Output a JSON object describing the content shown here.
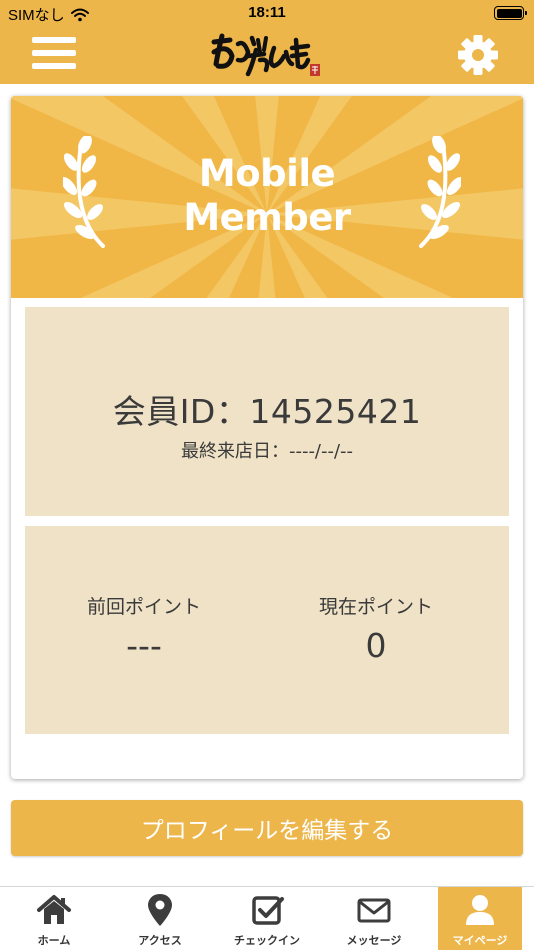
{
  "status_bar": {
    "carrier": "SIMなし",
    "time": "18:11"
  },
  "header": {
    "logo_text": "あかいやんも",
    "menu_icon": "hamburger-menu-icon",
    "settings_icon": "gear-icon"
  },
  "member_card": {
    "banner_line1": "Mobile",
    "banner_line2": "Member",
    "member_id_label": "会員ID：",
    "member_id": "14525421",
    "last_visit_label": "最終来店日：",
    "last_visit_date": "----/--/--",
    "previous_points_label": "前回ポイント",
    "previous_points_value": "---",
    "current_points_label": "現在ポイント",
    "current_points_value": "0"
  },
  "edit_profile_label": "プロフィールを編集する",
  "tabs": [
    {
      "label": "ホーム",
      "icon": "home-icon",
      "active": false
    },
    {
      "label": "アクセス",
      "icon": "map-pin-icon",
      "active": false
    },
    {
      "label": "チェックイン",
      "icon": "checkbox-icon",
      "active": false
    },
    {
      "label": "メッセージ",
      "icon": "envelope-icon",
      "active": false
    },
    {
      "label": "マイページ",
      "icon": "user-icon",
      "active": true
    }
  ],
  "colors": {
    "brand_yellow": "#edb64b",
    "panel_beige": "#efe2c7",
    "text_dark": "#3a3a3a"
  }
}
